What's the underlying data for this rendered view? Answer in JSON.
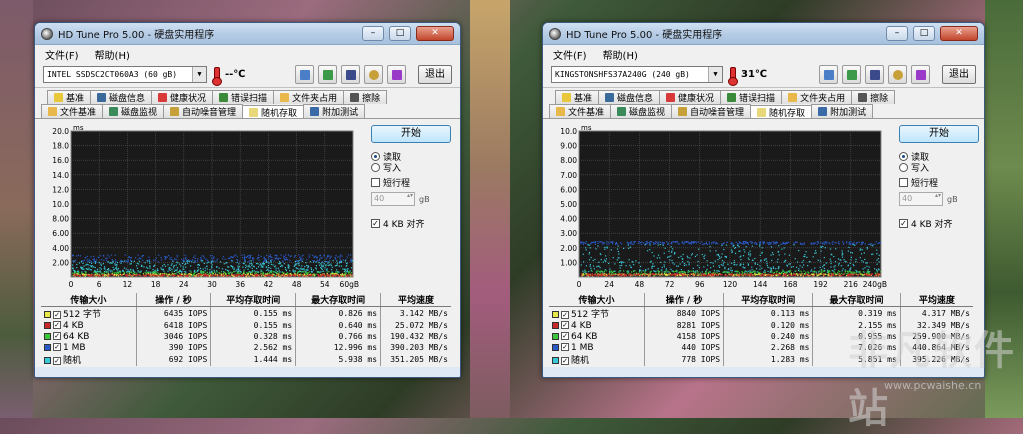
{
  "windows": [
    {
      "title": "HD Tune Pro 5.00 - 硬盘实用程序",
      "menu": [
        "文件(F)",
        "帮助(H)"
      ],
      "drive": "INTEL SSDSC2CT060A3 (60 gB)",
      "temperature": "--℃",
      "exit_label": "退出",
      "tabs_row1": [
        "基准",
        "磁盘信息",
        "健康状况",
        "错误扫描",
        "文件夹占用",
        "擦除"
      ],
      "tabs_row2": [
        "文件基准",
        "磁盘监视",
        "自动噪音管理",
        "随机存取",
        "附加测试"
      ],
      "active_tab": "随机存取",
      "start_label": "开始",
      "read_label": "读取",
      "write_label": "写入",
      "short_stroke_label": "短行程",
      "short_stroke_value": "40",
      "short_stroke_unit": "gB",
      "align_label": "4 KB 对齐",
      "table_headers": [
        "传输大小",
        "操作 / 秒",
        "平均存取时间",
        "最大存取时间",
        "平均速度"
      ],
      "rows": [
        {
          "label": "512 字节",
          "color": "#e8e84a",
          "ops": "6435 IOPS",
          "avg": "0.155 ms",
          "max": "0.826 ms",
          "speed": "3.142 MB/s"
        },
        {
          "label": "4 KB",
          "color": "#c82a2a",
          "ops": "6418 IOPS",
          "avg": "0.155 ms",
          "max": "0.640 ms",
          "speed": "25.072 MB/s"
        },
        {
          "label": "64 KB",
          "color": "#3ac83a",
          "ops": "3046 IOPS",
          "avg": "0.328 ms",
          "max": "0.766 ms",
          "speed": "190.432 MB/s"
        },
        {
          "label": "1 MB",
          "color": "#2a5ac8",
          "ops": "390 IOPS",
          "avg": "2.562 ms",
          "max": "12.996 ms",
          "speed": "390.203 MB/s"
        },
        {
          "label": "随机",
          "color": "#3ac8d8",
          "ops": "692 IOPS",
          "avg": "1.444 ms",
          "max": "5.938 ms",
          "speed": "351.205 MB/s"
        }
      ]
    },
    {
      "title": "HD Tune Pro 5.00 - 硬盘实用程序",
      "menu": [
        "文件(F)",
        "帮助(H)"
      ],
      "drive": "KINGSTONSHFS37A240G (240 gB)",
      "temperature": "31℃",
      "exit_label": "退出",
      "tabs_row1": [
        "基准",
        "磁盘信息",
        "健康状况",
        "错误扫描",
        "文件夹占用",
        "擦除"
      ],
      "tabs_row2": [
        "文件基准",
        "磁盘监视",
        "自动噪音管理",
        "随机存取",
        "附加测试"
      ],
      "active_tab": "随机存取",
      "start_label": "开始",
      "read_label": "读取",
      "write_label": "写入",
      "short_stroke_label": "短行程",
      "short_stroke_value": "40",
      "short_stroke_unit": "gB",
      "align_label": "4 KB 对齐",
      "table_headers": [
        "传输大小",
        "操作 / 秒",
        "平均存取时间",
        "最大存取时间",
        "平均速度"
      ],
      "rows": [
        {
          "label": "512 字节",
          "color": "#e8e84a",
          "ops": "8840 IOPS",
          "avg": "0.113 ms",
          "max": "0.319 ms",
          "speed": "4.317 MB/s"
        },
        {
          "label": "4 KB",
          "color": "#c82a2a",
          "ops": "8281 IOPS",
          "avg": "0.120 ms",
          "max": "2.155 ms",
          "speed": "32.349 MB/s"
        },
        {
          "label": "64 KB",
          "color": "#3ac83a",
          "ops": "4158 IOPS",
          "avg": "0.240 ms",
          "max": "0.955 ms",
          "speed": "259.900 MB/s"
        },
        {
          "label": "1 MB",
          "color": "#2a5ac8",
          "ops": "440 IOPS",
          "avg": "2.268 ms",
          "max": "7.026 ms",
          "speed": "440.864 MB/s"
        },
        {
          "label": "随机",
          "color": "#3ac8d8",
          "ops": "778 IOPS",
          "avg": "1.283 ms",
          "max": "5.851 ms",
          "speed": "395.226 MB/s"
        }
      ]
    }
  ],
  "chart_data": [
    {
      "type": "scatter",
      "ylabel": "ms",
      "ylim": [
        0,
        20
      ],
      "yticks": [
        "20.0",
        "18.0",
        "16.0",
        "14.0",
        "12.0",
        "10.0",
        "8.00",
        "6.00",
        "4.00",
        "2.00"
      ],
      "xlim": [
        0,
        60
      ],
      "xticks": [
        "0",
        "6",
        "12",
        "18",
        "24",
        "30",
        "36",
        "42",
        "48",
        "54",
        "60gB"
      ],
      "series": [
        {
          "color": "#2a5ac8",
          "y_range": [
            2.0,
            3.0
          ]
        },
        {
          "color": "#3ac8d8",
          "y_range": [
            0.6,
            2.2
          ]
        },
        {
          "color": "#3ac83a",
          "y_range": [
            0.1,
            0.7
          ]
        },
        {
          "color": "#e8e84a",
          "y_range": [
            0.05,
            0.4
          ]
        },
        {
          "color": "#c82a2a",
          "y_range": [
            0.05,
            0.3
          ]
        }
      ]
    },
    {
      "type": "scatter",
      "ylabel": "ms",
      "ylim": [
        0,
        10
      ],
      "yticks": [
        "10.0",
        "9.00",
        "8.00",
        "7.00",
        "6.00",
        "5.00",
        "4.00",
        "3.00",
        "2.00",
        "1.00"
      ],
      "xlim": [
        0,
        240
      ],
      "xticks": [
        "0",
        "24",
        "48",
        "72",
        "96",
        "120",
        "144",
        "168",
        "192",
        "216",
        "240gB"
      ],
      "series": [
        {
          "color": "#2a5ac8",
          "y_range": [
            2.2,
            2.4
          ]
        },
        {
          "color": "#3ac8d8",
          "y_range": [
            0.3,
            2.2
          ]
        },
        {
          "color": "#3ac83a",
          "y_range": [
            0.1,
            0.4
          ]
        },
        {
          "color": "#e8e84a",
          "y_range": [
            0.05,
            0.2
          ]
        },
        {
          "color": "#c82a2a",
          "y_range": [
            0.05,
            0.2
          ]
        }
      ]
    }
  ],
  "watermark": {
    "logo": "非凡软件站",
    "url": "www.pcwaishe.cn"
  }
}
